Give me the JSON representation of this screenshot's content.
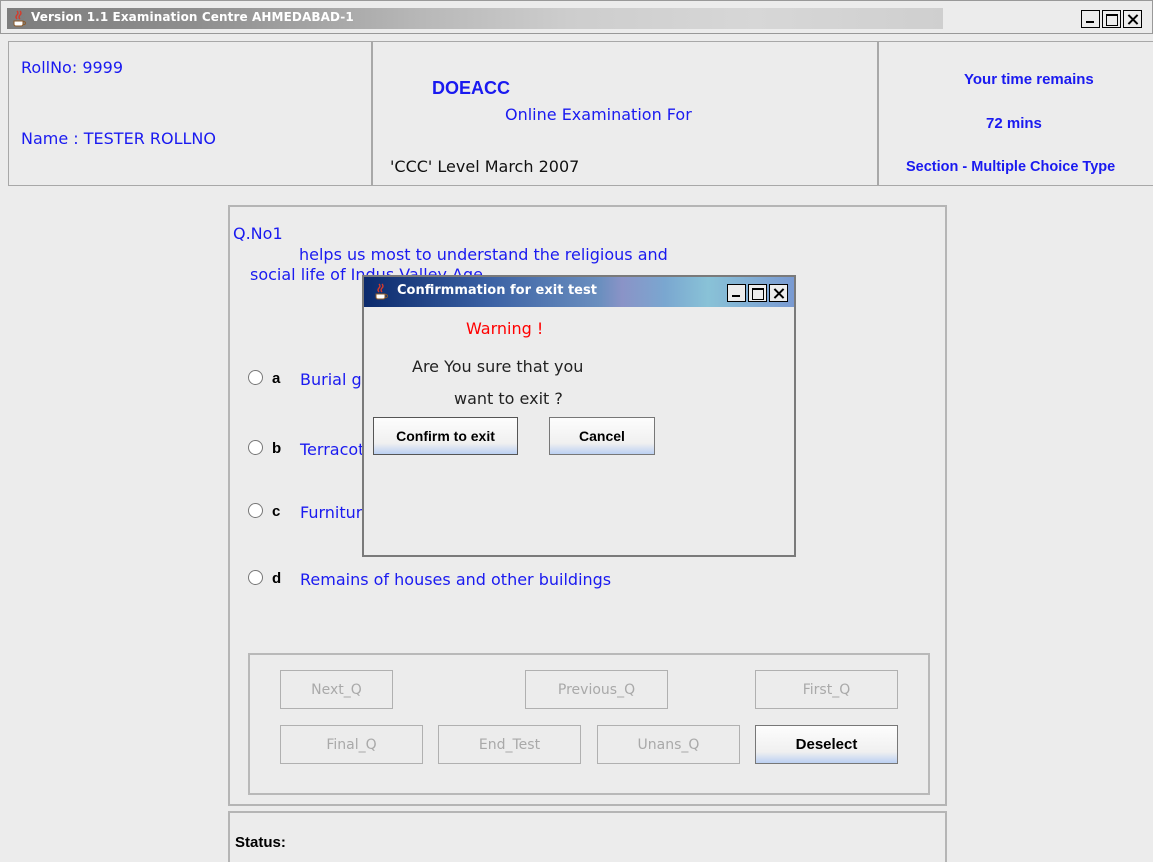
{
  "window": {
    "title": "Version 1.1 Examination Centre AHMEDABAD-1"
  },
  "header": {
    "roll_no": "RollNo: 9999",
    "name": "Name : TESTER ROLLNO",
    "org": "DOEACC",
    "exam_for": "Online Examination For",
    "level": "'CCC' Level March 2007",
    "time_label": "Your time remains",
    "time_value": "72  mins",
    "section": "Section - Multiple Choice Type"
  },
  "question": {
    "number": "Q.No1",
    "text_line1": "helps us most to understand the religious and",
    "text_line2": "social life of Indus Valley Age.",
    "options": [
      {
        "key": "a",
        "text": "Burial grounds"
      },
      {
        "key": "b",
        "text": "Terracotta"
      },
      {
        "key": "c",
        "text": "Furniture"
      },
      {
        "key": "d",
        "text": "Remains of houses and other buildings"
      }
    ]
  },
  "nav": {
    "next": "Next_Q",
    "previous": "Previous_Q",
    "first": "First_Q",
    "final": "Final_Q",
    "end_test": "End_Test",
    "unans": "Unans_Q",
    "deselect": "Deselect"
  },
  "status": {
    "label": "Status:"
  },
  "dialog": {
    "title": "Confirmmation for exit test",
    "warning": "Warning !",
    "line1": "Are You sure that you",
    "line2": "want to exit ?",
    "confirm": "Confirm to exit",
    "cancel": "Cancel"
  },
  "colors": {
    "accent_blue": "#1a1af0",
    "warning_red": "#ff0000",
    "disabled_text": "#a9a9a9"
  }
}
